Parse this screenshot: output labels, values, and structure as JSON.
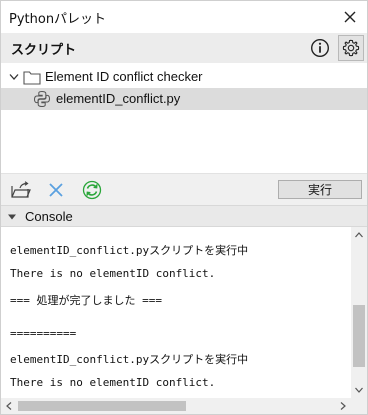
{
  "window": {
    "title": "Pythonパレット"
  },
  "header": {
    "label": "スクリプト"
  },
  "tree": {
    "folder_label": "Element ID conflict checker",
    "file_label": "elementID_conflict.py"
  },
  "toolbar": {
    "run_label": "実行"
  },
  "console": {
    "label": "Console",
    "lines": [
      "elementID_conflict.pyスクリプトを実行中",
      "There is no elementID conflict.",
      "=== 処理が完了しました ===",
      "",
      "==========",
      "elementID_conflict.pyスクリプトを実行中",
      "There is no elementID conflict."
    ]
  },
  "colors": {
    "refresh_green": "#2aa63a",
    "delete_blue": "#5aa0e0",
    "folder_stroke": "#555555"
  }
}
